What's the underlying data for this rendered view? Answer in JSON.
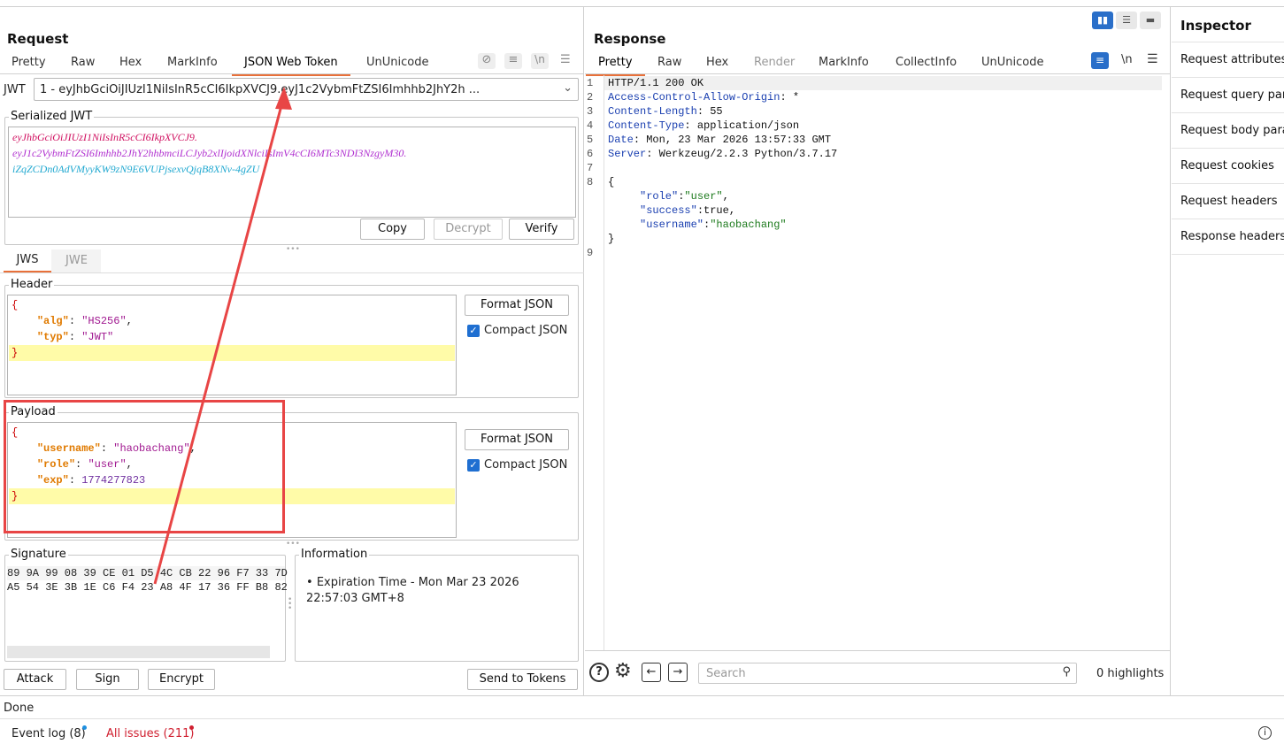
{
  "request": {
    "title": "Request",
    "tabs": [
      "Pretty",
      "Raw",
      "Hex",
      "MarkInfo",
      "JSON Web Token",
      "UnUnicode"
    ],
    "jwt_label": "JWT",
    "jwt_select": "1 - eyJhbGciOiJIUzI1NiIsInR5cCI6IkpXVCJ9.eyJ1c2VybmFtZSI6Imhhb2JhY2h ...",
    "serialized_label": "Serialized JWT",
    "serialized_parts": [
      "eyJhbGciOiJIUzI1NiIsInR5cCI6IkpXVCJ9.",
      "eyJ1c2VybmFtZSI6Imhhb2JhY2hhbmciLCJyb2xlIjoidXNlciIsImV4cCI6MTc3NDI3NzgyM30.",
      "iZqZCDn0AdVMyyKW9zN9E6VUPjsexvQjqB8XNv-4gZU"
    ],
    "buttons": {
      "copy": "Copy",
      "decrypt": "Decrypt",
      "verify": "Verify"
    },
    "subtabs": [
      "JWS",
      "JWE"
    ],
    "header_label": "Header",
    "header_json": {
      "alg": "HS256",
      "typ": "JWT"
    },
    "payload_label": "Payload",
    "payload_json": {
      "username": "haobachang",
      "role": "user",
      "exp": "1774277823"
    },
    "format_json": "Format JSON",
    "compact_json": "Compact JSON",
    "signature_label": "Signature",
    "signature_hex": [
      "89 9A 99 08 39 CE 01 D5 4C CB 22 96 F7 33 7D",
      "A5 54 3E 3B 1E C6 F4 23 A8 4F 17 36 FF B8 82"
    ],
    "information_label": "Information",
    "information_items": [
      "Expiration Time - Mon Mar 23 2026 22:57:03 GMT+8"
    ],
    "bottom_buttons": {
      "attack": "Attack",
      "sign": "Sign",
      "encrypt": "Encrypt",
      "send": "Send to Tokens"
    }
  },
  "response": {
    "title": "Response",
    "tabs": [
      "Pretty",
      "Raw",
      "Hex",
      "Render",
      "MarkInfo",
      "CollectInfo",
      "UnUnicode"
    ],
    "lines": [
      {
        "num": "1",
        "text": "HTTP/1.1 200 OK"
      },
      {
        "num": "2",
        "key": "Access-Control-Allow-Origin",
        "val": " *"
      },
      {
        "num": "3",
        "key": "Content-Length",
        "val": " 55"
      },
      {
        "num": "4",
        "key": "Content-Type",
        "val": " application/json"
      },
      {
        "num": "5",
        "key": "Date",
        "val": " Mon, 23 Mar 2026 13:57:33 GMT"
      },
      {
        "num": "6",
        "key": "Server",
        "val": " Werkzeug/2.2.3 Python/3.7.17"
      },
      {
        "num": "7",
        "text": ""
      },
      {
        "num": "8",
        "text": "{"
      },
      {
        "num": "",
        "jk": "\"role\"",
        "jv": "\"user\"",
        "tail": ","
      },
      {
        "num": "",
        "jk": "\"success\"",
        "jv": "true",
        "tail": ","
      },
      {
        "num": "",
        "jk": "\"username\"",
        "jv": "\"haobachang\"",
        "tail": ""
      },
      {
        "num": "",
        "text": "}"
      },
      {
        "num": "9",
        "text": ""
      }
    ],
    "search_placeholder": "Search",
    "highlights": "0 highlights"
  },
  "inspector": {
    "title": "Inspector",
    "items": [
      "Request attributes",
      "Request query parameters",
      "Request body parameters",
      "Request cookies",
      "Request headers",
      "Response headers"
    ]
  },
  "status": {
    "done": "Done",
    "event_log": "Event log (8)",
    "all_issues": "All issues (211)"
  },
  "colors": {
    "accent": "#e8703a",
    "annotation": "#e84545",
    "check": "#1f6fd1"
  }
}
